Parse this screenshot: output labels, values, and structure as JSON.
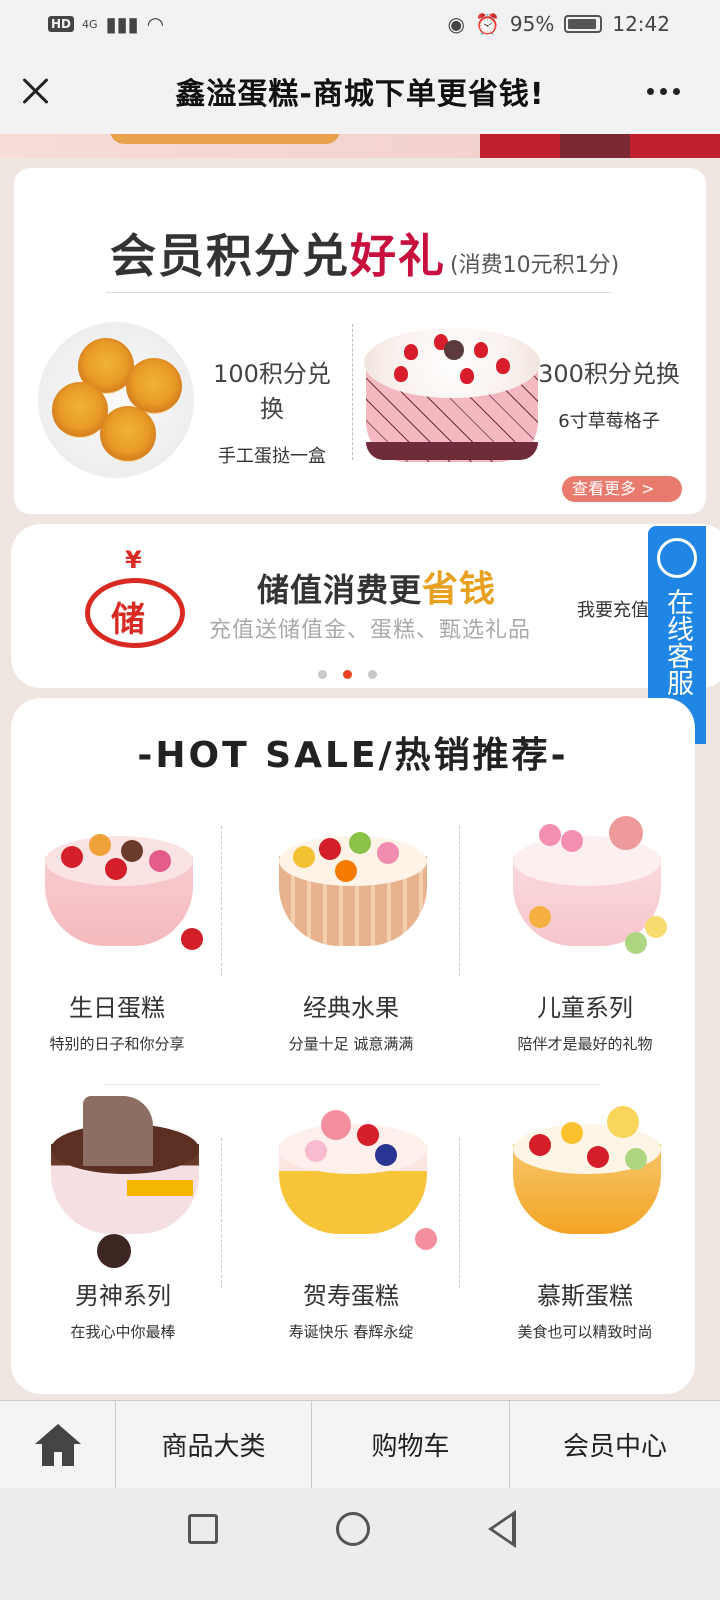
{
  "status_bar": {
    "network": "4G",
    "battery": "95%",
    "time": "12:42"
  },
  "header": {
    "title": "鑫溢蛋糕-商城下单更省钱!"
  },
  "points_card": {
    "title_main": "会员积分兑",
    "title_highlight": "好礼",
    "title_note": "(消费10元积1分)",
    "rewards": [
      {
        "points": "100积分兑换",
        "item": "手工蛋挞一盒"
      },
      {
        "points": "300积分兑换",
        "item": "6寸草莓格子"
      }
    ],
    "more_label": "查看更多  >"
  },
  "recharge_card": {
    "icon_char": "储",
    "title_main": "储值消费更",
    "title_highlight": "省钱",
    "subtitle": "充值送储值金、蛋糕、甄选礼品",
    "link": "我要充值"
  },
  "carousel": {
    "total": 3,
    "active": 2
  },
  "service": {
    "label": "在线客服"
  },
  "hot_sale": {
    "title": "-HOT SALE/热销推荐-",
    "products": [
      {
        "name": "生日蛋糕",
        "desc": "特别的日子和你分享"
      },
      {
        "name": "经典水果",
        "desc": "分量十足 诚意满满"
      },
      {
        "name": "儿童系列",
        "desc": "陪伴才是最好的礼物"
      },
      {
        "name": "男神系列",
        "desc": "在我心中你最棒"
      },
      {
        "name": "贺寿蛋糕",
        "desc": "寿诞快乐 春辉永绽"
      },
      {
        "name": "慕斯蛋糕",
        "desc": "美食也可以精致时尚"
      }
    ]
  },
  "bottom_nav": {
    "home_icon": "home-icon",
    "items": [
      "商品大类",
      "购物车",
      "会员中心"
    ]
  },
  "colors": {
    "accent_red": "#c8103f",
    "gold": "#e8a020",
    "service_blue": "#1f86e6",
    "dot_active": "#e8421f"
  }
}
